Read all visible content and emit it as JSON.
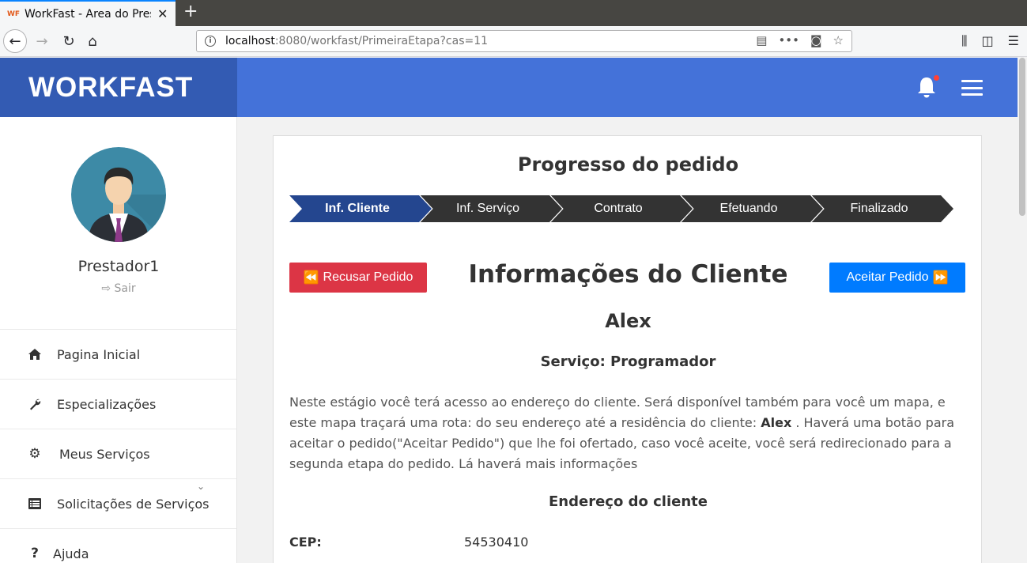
{
  "browser": {
    "tab_title": "WorkFast - Area do Prest",
    "favicon": "WF",
    "url_host": "localhost",
    "url_rest": ":8080/workfast/PrimeiraEtapa?cas=11"
  },
  "brand": "WORKFAST",
  "colors": {
    "brand_bg": "#335bb3",
    "topbar_bg": "#4472d9",
    "step_active": "#24468f",
    "step_inactive": "#333333",
    "refuse": "#dc3545",
    "accept": "#007bff"
  },
  "sidebar": {
    "username": "Prestador1",
    "logout": "Sair",
    "items": [
      {
        "label": "Pagina Inicial",
        "icon": "home-icon"
      },
      {
        "label": "Especializações",
        "icon": "wrench-icon"
      },
      {
        "label": "Meus Serviços",
        "icon": "cogs-icon"
      },
      {
        "label": "Solicitações de Serviços",
        "icon": "list-icon"
      },
      {
        "label": "Ajuda",
        "icon": "question-icon"
      }
    ]
  },
  "main": {
    "progress_title": "Progresso do pedido",
    "steps": [
      "Inf. Cliente",
      "Inf. Serviço",
      "Contrato",
      "Efetuando",
      "Finalizado"
    ],
    "active_step": 0,
    "refuse_label": "Recusar Pedido",
    "accept_label": "Aceitar Pedido",
    "section_title": "Informações do Cliente",
    "client_name": "Alex",
    "service_line": "Serviço: Programador",
    "desc_part1": "Neste estágio você terá acesso ao endereço do cliente. Será disponível também para você um mapa, e este mapa traçará uma rota: do seu endereço até a residência do cliente: ",
    "desc_name": "Alex",
    "desc_part2": " . Haverá uma botão para aceitar o pedido(\"Aceitar Pedido\") que lhe foi ofertado, caso você aceite, você será redirecionado para a segunda etapa do pedido. Lá haverá mais informações",
    "address_title": "Endereço do cliente",
    "cep_label": "CEP:",
    "cep_value": "54530410"
  }
}
